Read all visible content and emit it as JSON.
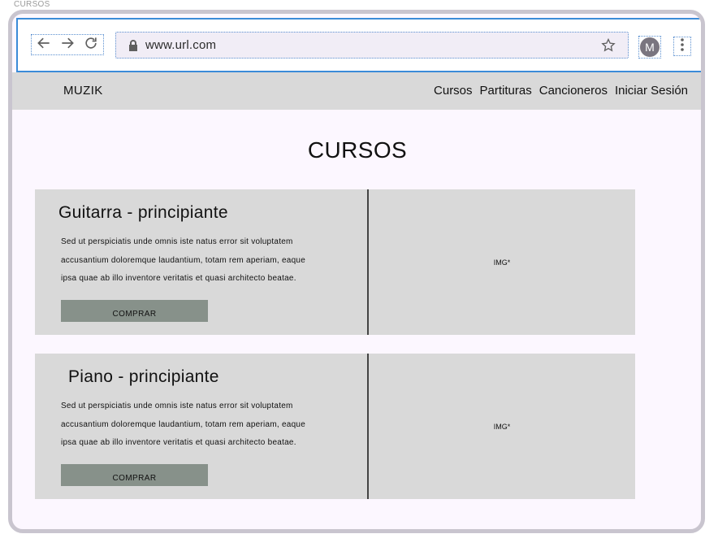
{
  "frame": {
    "label": "CURSOS"
  },
  "browser": {
    "url": "www.url.com",
    "avatar_initial": "M"
  },
  "site": {
    "brand": "MUZIK",
    "menu": [
      "Cursos",
      "Partituras",
      "Cancioneros",
      "Iniciar Sesión"
    ]
  },
  "page": {
    "title": "CURSOS"
  },
  "courses": [
    {
      "title": "Guitarra - principiante",
      "lines": [
        "Sed ut perspiciatis unde omnis iste natus error sit voluptatem",
        "accusantium doloremque laudantium, totam rem aperiam, eaque",
        "ipsa quae ab illo inventore veritatis et quasi architecto beatae."
      ],
      "button": "COMPRAR",
      "image_placeholder": "IMG*"
    },
    {
      "title": "Piano - principiante",
      "lines": [
        "Sed ut perspiciatis unde omnis iste natus error sit voluptatem",
        "accusantium doloremque laudantium, totam rem aperiam, eaque",
        "ipsa quae ab illo inventore veritatis et quasi architecto beatae."
      ],
      "button": "COMPRAR",
      "image_placeholder": "IMG*"
    }
  ],
  "icons": [
    "back-arrow-icon",
    "forward-arrow-icon",
    "reload-icon",
    "lock-icon",
    "star-icon",
    "more-vertical-icon"
  ],
  "colors": {
    "browser_outline": "#3b8bd8",
    "device_border": "#c9c5cf",
    "page_background": "#fcf7ff",
    "navbar_background": "#d9d9d9",
    "card_background": "#d9d9d9",
    "button_background": "#87918a"
  }
}
